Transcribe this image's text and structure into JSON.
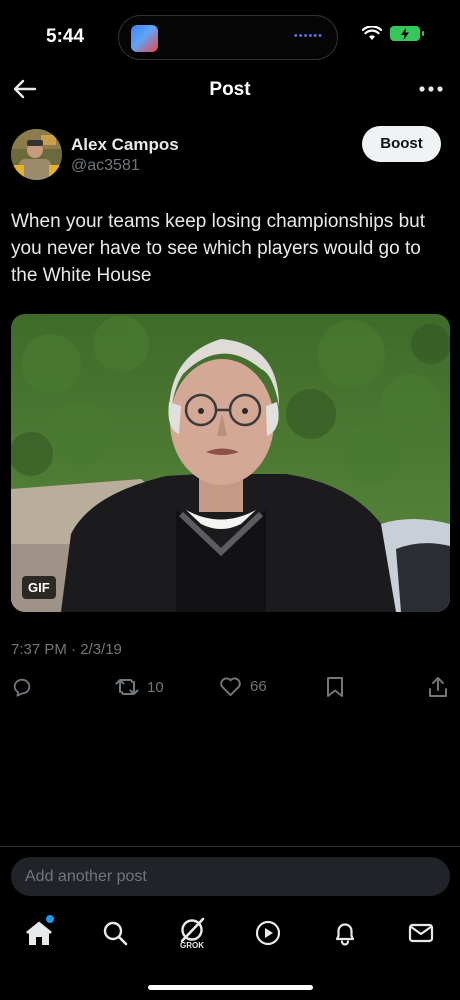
{
  "status_bar": {
    "time": "5:44"
  },
  "header": {
    "title": "Post"
  },
  "post": {
    "author_name": "Alex Campos",
    "author_handle": "@ac3581",
    "boost_label": "Boost",
    "text": "When your teams keep losing championships but you never have to see which players would go to the White House",
    "media_badge": "GIF",
    "timestamp": "7:37 PM · 2/3/19",
    "retweet_count": "10",
    "like_count": "66"
  },
  "reply": {
    "placeholder": "Add another post"
  },
  "tabbar": {
    "grok_label": "GROK",
    "icons": [
      "home-icon",
      "search-icon",
      "grok-icon",
      "video-icon",
      "notifications-icon",
      "messages-icon"
    ]
  },
  "colors": {
    "accent": "#1d9bf0",
    "muted": "#71767b",
    "battery": "#34c759"
  }
}
